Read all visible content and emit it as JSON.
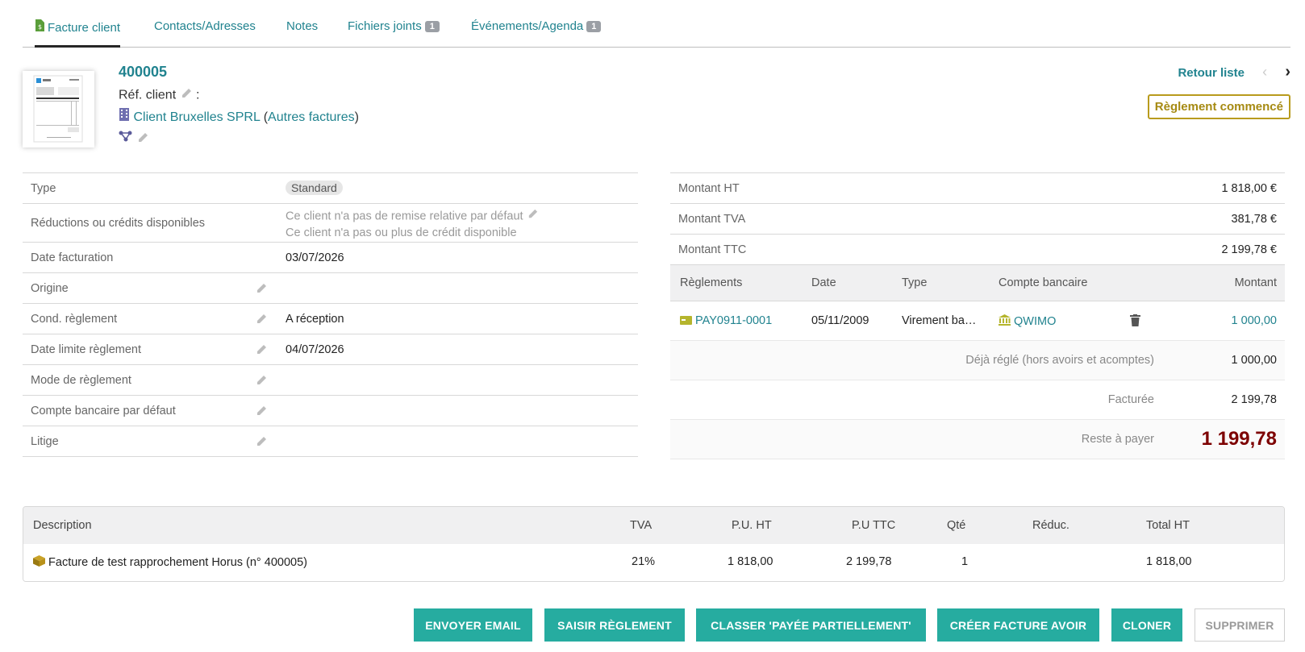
{
  "tabs": [
    {
      "label": "Facture client",
      "badge": ""
    },
    {
      "label": "Contacts/Adresses",
      "badge": ""
    },
    {
      "label": "Notes",
      "badge": ""
    },
    {
      "label": "Fichiers joints",
      "badge": "1"
    },
    {
      "label": "Événements/Agenda",
      "badge": "1"
    }
  ],
  "header": {
    "ref": "400005",
    "ref_client_label": "Réf. client",
    "ref_client_sep": ":",
    "client_name": "Client Bruxelles SPRL",
    "other_invoices": "Autres factures",
    "retour_liste": "Retour liste",
    "status": "Règlement commencé"
  },
  "details": {
    "type_label": "Type",
    "type_value": "Standard",
    "reductions_label": "Réductions ou crédits disponibles",
    "reductions_line1": "Ce client n'a pas de remise relative par défaut",
    "reductions_line2": "Ce client n'a pas ou plus de crédit disponible",
    "date_label": "Date facturation",
    "date_value": "03/07/2026",
    "origine_label": "Origine",
    "origine_value": "",
    "cond_label": "Cond. règlement",
    "cond_value": "A réception",
    "date_limite_label": "Date limite règlement",
    "date_limite_value": "04/07/2026",
    "mode_label": "Mode de règlement",
    "mode_value": "",
    "compte_label": "Compte bancaire par défaut",
    "compte_value": "",
    "litige_label": "Litige",
    "litige_value": ""
  },
  "amounts": {
    "ht_label": "Montant HT",
    "ht_value": "1 818,00 €",
    "tva_label": "Montant TVA",
    "tva_value": "381,78 €",
    "ttc_label": "Montant TTC",
    "ttc_value": "2 199,78 €"
  },
  "payments": {
    "headers": [
      "Règlements",
      "Date",
      "Type",
      "Compte bancaire",
      "Montant"
    ],
    "row": {
      "ref": "PAY0911-0001",
      "date": "05/11/2009",
      "type": "Virement ba…",
      "account": "QWIMO",
      "amount": "1 000,00"
    },
    "deja_label": "Déjà réglé (hors avoirs et acomptes)",
    "deja_value": "1 000,00",
    "facturee_label": "Facturée",
    "facturee_value": "2 199,78",
    "reste_label": "Reste à payer",
    "reste_value": "1 199,78"
  },
  "lines": {
    "headers": [
      "Description",
      "TVA",
      "P.U. HT",
      "P.U TTC",
      "Qté",
      "Réduc.",
      "Total HT"
    ],
    "rows": [
      {
        "description": "Facture de test rapprochement Horus (n° 400005)",
        "tva": "21%",
        "pu_ht": "1 818,00",
        "pu_ttc": "2 199,78",
        "qty": "1",
        "reduc": "",
        "total_ht": "1 818,00"
      }
    ]
  },
  "buttons": {
    "email": "ENVOYER EMAIL",
    "payment": "SAISIR RÈGLEMENT",
    "classify": "CLASSER 'PAYÉE PARTIELLEMENT'",
    "credit_note": "CRÉER FACTURE AVOIR",
    "clone": "CLONER",
    "delete": "SUPPRIMER"
  },
  "colors": {
    "accent": "#21838f",
    "button": "#26aca0",
    "status": "#b89b1d",
    "remaining": "#7d0000"
  }
}
